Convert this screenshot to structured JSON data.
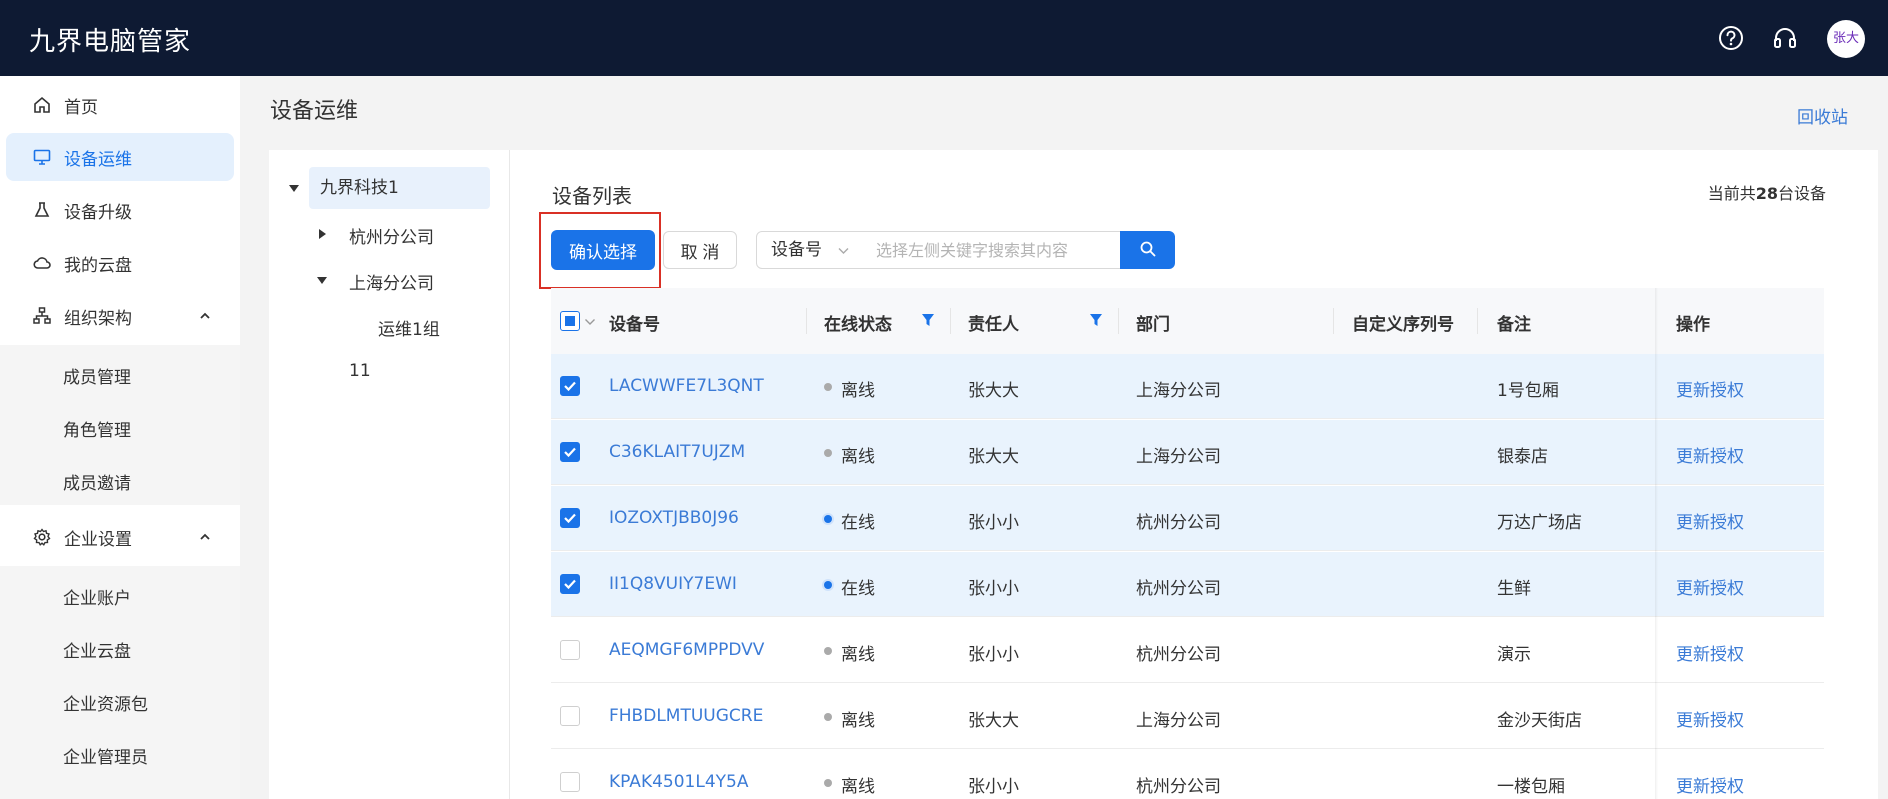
{
  "app": {
    "title": "九界电脑管家"
  },
  "user": {
    "avatar_text": "张大"
  },
  "sidebar": {
    "items": [
      {
        "label": "首页",
        "icon": "home-icon"
      },
      {
        "label": "设备运维",
        "icon": "monitor-icon",
        "active": true
      },
      {
        "label": "设备升级",
        "icon": "flask-icon"
      },
      {
        "label": "我的云盘",
        "icon": "cloud-icon"
      },
      {
        "label": "组织架构",
        "icon": "org-tree-icon",
        "expanded": true
      },
      {
        "label": "企业设置",
        "icon": "gear-icon",
        "expanded": true
      }
    ],
    "org_sub": [
      "成员管理",
      "角色管理",
      "成员邀请"
    ],
    "enterprise_sub": [
      "企业账户",
      "企业云盘",
      "企业资源包",
      "企业管理员"
    ]
  },
  "page": {
    "title": "设备运维",
    "recycle_link": "回收站"
  },
  "tree": {
    "root": "九界科技1",
    "children": [
      "杭州分公司",
      "上海分公司"
    ],
    "grandchildren": [
      "运维1组"
    ],
    "other": "11"
  },
  "list": {
    "title": "设备列表",
    "count_prefix": "当前共",
    "count_value": "28",
    "count_suffix": "台设备"
  },
  "toolbar": {
    "confirm_label": "确认选择",
    "cancel_label": "取 消",
    "select_value": "设备号",
    "search_placeholder": "选择左侧关键字搜索其内容"
  },
  "table": {
    "columns": [
      "设备号",
      "在线状态",
      "责任人",
      "部门",
      "自定义序列号",
      "备注",
      "操作"
    ],
    "rows": [
      {
        "device": "LACWWFE7L3QNT",
        "status": "离线",
        "online": false,
        "owner": "张大大",
        "dept": "上海分公司",
        "serial": "",
        "note": "1号包厢",
        "action": "更新授权",
        "checked": true
      },
      {
        "device": "C36KLAIT7UJZM",
        "status": "离线",
        "online": false,
        "owner": "张大大",
        "dept": "上海分公司",
        "serial": "",
        "note": "银泰店",
        "action": "更新授权",
        "checked": true
      },
      {
        "device": "IOZOXTJBB0J96",
        "status": "在线",
        "online": true,
        "owner": "张小小",
        "dept": "杭州分公司",
        "serial": "",
        "note": "万达广场店",
        "action": "更新授权",
        "checked": true
      },
      {
        "device": "II1Q8VUIY7EWI",
        "status": "在线",
        "online": true,
        "owner": "张小小",
        "dept": "杭州分公司",
        "serial": "",
        "note": "生鲜",
        "action": "更新授权",
        "checked": true
      },
      {
        "device": "AEQMGF6MPPDVV",
        "status": "离线",
        "online": false,
        "owner": "张小小",
        "dept": "杭州分公司",
        "serial": "",
        "note": "演示",
        "action": "更新授权",
        "checked": false
      },
      {
        "device": "FHBDLMTUUGCRE",
        "status": "离线",
        "online": false,
        "owner": "张大大",
        "dept": "上海分公司",
        "serial": "",
        "note": "金沙天街店",
        "action": "更新授权",
        "checked": false
      },
      {
        "device": "KPAK4501L4Y5A",
        "status": "离线",
        "online": false,
        "owner": "张小小",
        "dept": "杭州分公司",
        "serial": "",
        "note": "一楼包厢",
        "action": "更新授权",
        "checked": false
      }
    ]
  },
  "colors": {
    "primary": "#1a73e8",
    "topbar": "#0e1a33",
    "link": "#3b7bd6",
    "highlight": "#d93025"
  }
}
